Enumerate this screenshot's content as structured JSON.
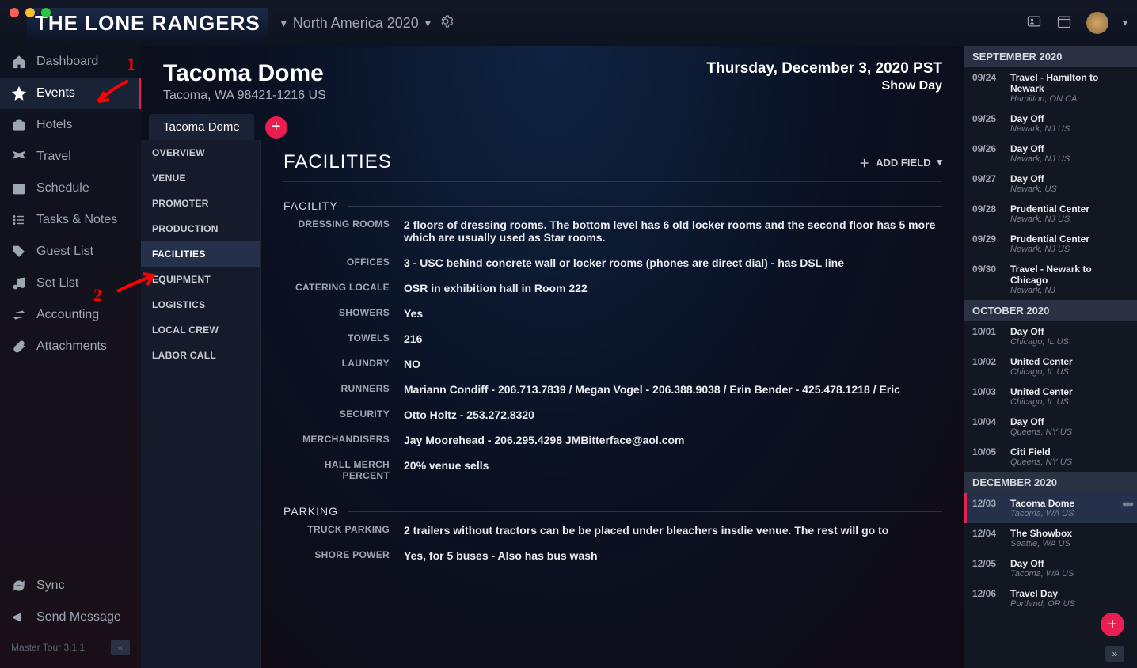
{
  "app": {
    "logo": "THE LONE RANGERS",
    "tour": "North America 2020",
    "version": "Master Tour 3.1.1"
  },
  "sidebar": {
    "items": [
      {
        "label": "Dashboard",
        "icon": "home"
      },
      {
        "label": "Events",
        "icon": "star",
        "active": true
      },
      {
        "label": "Hotels",
        "icon": "briefcase"
      },
      {
        "label": "Travel",
        "icon": "plane"
      },
      {
        "label": "Schedule",
        "icon": "calendar"
      },
      {
        "label": "Tasks & Notes",
        "icon": "list"
      },
      {
        "label": "Guest List",
        "icon": "tag"
      },
      {
        "label": "Set List",
        "icon": "music"
      },
      {
        "label": "Accounting",
        "icon": "transfer"
      },
      {
        "label": "Attachments",
        "icon": "paperclip"
      }
    ],
    "bottom": [
      {
        "label": "Sync",
        "icon": "sync"
      },
      {
        "label": "Send Message",
        "icon": "megaphone"
      }
    ]
  },
  "header": {
    "title": "Tacoma Dome",
    "subtitle": "Tacoma, WA 98421-1216 US",
    "date": "Thursday, December 3, 2020 PST",
    "dayType": "Show Day"
  },
  "tabs": {
    "active": "Tacoma Dome"
  },
  "subnav": [
    "OVERVIEW",
    "VENUE",
    "PROMOTER",
    "PRODUCTION",
    "FACILITIES",
    "EQUIPMENT",
    "LOGISTICS",
    "LOCAL CREW",
    "LABOR CALL"
  ],
  "subnavActive": "FACILITIES",
  "panel": {
    "title": "FACILITIES",
    "addField": "ADD FIELD",
    "sections": [
      {
        "title": "FACILITY",
        "fields": [
          {
            "label": "DRESSING ROOMS",
            "value": "2 floors of dressing rooms. The bottom level has 6 old locker rooms and the second floor has 5 more which are usually used as Star rooms."
          },
          {
            "label": "OFFICES",
            "value": "3 - USC behind concrete wall or locker rooms (phones are direct dial) - has DSL line"
          },
          {
            "label": "CATERING LOCALE",
            "value": "OSR in exhibition hall in Room 222"
          },
          {
            "label": "SHOWERS",
            "value": "Yes"
          },
          {
            "label": "TOWELS",
            "value": "216"
          },
          {
            "label": "LAUNDRY",
            "value": "NO"
          },
          {
            "label": "RUNNERS",
            "value": "Mariann Condiff - 206.713.7839 / Megan Vogel - 206.388.9038 / Erin Bender - 425.478.1218 / Eric"
          },
          {
            "label": "SECURITY",
            "value": "Otto Holtz - 253.272.8320"
          },
          {
            "label": "MERCHANDISERS",
            "value": "Jay Moorehead - 206.295.4298   JMBitterface@aol.com"
          },
          {
            "label": "HALL MERCH PERCENT",
            "value": "20% venue sells"
          }
        ]
      },
      {
        "title": "PARKING",
        "fields": [
          {
            "label": "TRUCK PARKING",
            "value": "2 trailers without tractors can be be placed under bleachers insdie venue. The rest will go to"
          },
          {
            "label": "SHORE POWER",
            "value": "Yes, for 5 buses - Also has bus wash"
          }
        ]
      }
    ]
  },
  "calendar": {
    "months": [
      {
        "label": "SEPTEMBER 2020",
        "items": [
          {
            "date": "09/24",
            "title": "Travel - Hamilton to Newark",
            "sub": "Hamilton, ON CA"
          },
          {
            "date": "09/25",
            "title": "Day Off",
            "sub": "Newark, NJ US"
          },
          {
            "date": "09/26",
            "title": "Day Off",
            "sub": "Newark, NJ US"
          },
          {
            "date": "09/27",
            "title": "Day Off",
            "sub": "Newark, US"
          },
          {
            "date": "09/28",
            "title": "Prudential Center",
            "sub": "Newark, NJ US"
          },
          {
            "date": "09/29",
            "title": "Prudential Center",
            "sub": "Newark, NJ US"
          },
          {
            "date": "09/30",
            "title": "Travel - Newark to Chicago",
            "sub": "Newark, NJ"
          }
        ]
      },
      {
        "label": "OCTOBER 2020",
        "items": [
          {
            "date": "10/01",
            "title": "Day Off",
            "sub": "Chicago, IL US"
          },
          {
            "date": "10/02",
            "title": "United Center",
            "sub": "Chicago, IL US"
          },
          {
            "date": "10/03",
            "title": "United Center",
            "sub": "Chicago, IL US"
          },
          {
            "date": "10/04",
            "title": "Day Off",
            "sub": "Queens, NY US"
          },
          {
            "date": "10/05",
            "title": "Citi Field",
            "sub": "Queens, NY US"
          }
        ]
      },
      {
        "label": "DECEMBER 2020",
        "items": [
          {
            "date": "12/03",
            "title": "Tacoma Dome",
            "sub": "Tacoma, WA US",
            "active": true
          },
          {
            "date": "12/04",
            "title": "The Showbox",
            "sub": "Seattle, WA US"
          },
          {
            "date": "12/05",
            "title": "Day Off",
            "sub": "Tacoma, WA US"
          },
          {
            "date": "12/06",
            "title": "Travel Day",
            "sub": "Portland, OR US"
          }
        ]
      }
    ]
  },
  "annotations": {
    "num1": "1",
    "num2": "2"
  }
}
